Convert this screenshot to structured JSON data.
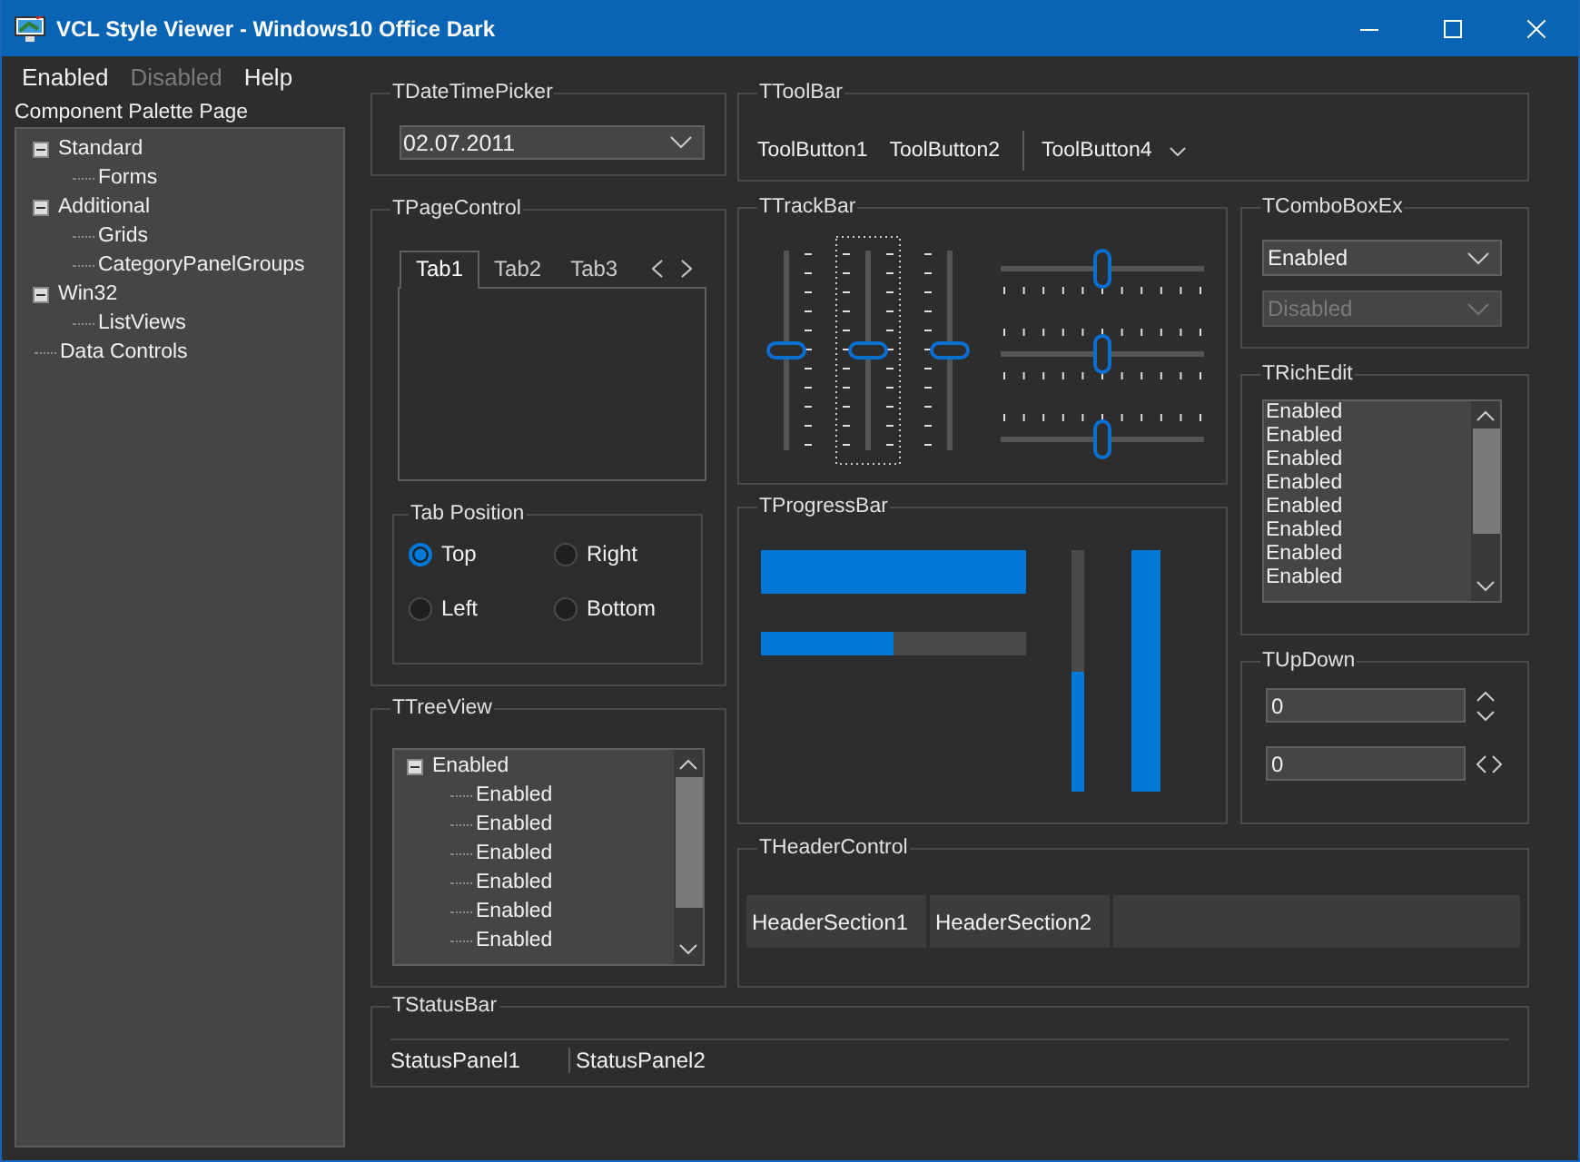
{
  "window": {
    "title": "VCL Style Viewer - Windows10 Office Dark"
  },
  "menu": [
    {
      "label": "Enabled",
      "disabled": false
    },
    {
      "label": "Disabled",
      "disabled": true
    },
    {
      "label": "Help",
      "disabled": false
    }
  ],
  "palette": {
    "title": "Component Palette Page",
    "tree": [
      {
        "label": "Standard",
        "expanded": true,
        "children": [
          {
            "label": "Forms"
          }
        ]
      },
      {
        "label": "Additional",
        "expanded": true,
        "children": [
          {
            "label": "Grids"
          },
          {
            "label": "CategoryPanelGroups"
          }
        ]
      },
      {
        "label": "Win32",
        "expanded": true,
        "children": [
          {
            "label": "ListViews"
          }
        ]
      },
      {
        "label": "Data Controls"
      }
    ]
  },
  "date_time_picker": {
    "title": "TDateTimePicker",
    "value": "02.07.2011"
  },
  "toolbar": {
    "title": "TToolBar",
    "buttons": [
      {
        "kind": "button",
        "label": "ToolButton1"
      },
      {
        "kind": "button",
        "label": "ToolButton2"
      },
      {
        "kind": "separator"
      },
      {
        "kind": "dropdown",
        "label": "ToolButton4"
      }
    ]
  },
  "page_control": {
    "title": "TPageControl",
    "tabs": [
      {
        "label": "Tab1",
        "selected": true
      },
      {
        "label": "Tab2",
        "selected": false
      },
      {
        "label": "Tab3",
        "selected": false
      }
    ],
    "tab_position": {
      "title": "Tab Position",
      "options": [
        {
          "label": "Top",
          "selected": true
        },
        {
          "label": "Right",
          "selected": false
        },
        {
          "label": "Left",
          "selected": false
        },
        {
          "label": "Bottom",
          "selected": false
        }
      ]
    }
  },
  "tree_view": {
    "title": "TTreeView",
    "items": [
      {
        "label": "Enabled",
        "expanded": true,
        "children": [
          {
            "label": "Enabled"
          },
          {
            "label": "Enabled"
          },
          {
            "label": "Enabled"
          },
          {
            "label": "Enabled"
          },
          {
            "label": "Enabled"
          },
          {
            "label": "Enabled"
          }
        ]
      }
    ]
  },
  "track_bar": {
    "title": "TTrackBar",
    "vertical": [
      {
        "level": 0.5,
        "kind": "right",
        "focused": false
      },
      {
        "level": 0.5,
        "kind": "both",
        "focused": true
      },
      {
        "level": 0.5,
        "kind": "left",
        "focused": false
      }
    ],
    "horizontal": [
      {
        "level": 0.5,
        "kind": "below",
        "focused": false
      },
      {
        "level": 0.5,
        "kind": "both",
        "focused": false
      },
      {
        "level": 0.5,
        "kind": "above",
        "focused": false
      }
    ]
  },
  "progress_bar": {
    "title": "TProgressBar",
    "bars": [
      {
        "kind": "horizontal",
        "thick": true,
        "level": 1
      },
      {
        "kind": "horizontal",
        "thick": false,
        "level": 0.5
      },
      {
        "kind": "vertical",
        "thick": false,
        "level": 0.5
      },
      {
        "kind": "vertical",
        "thick": true,
        "level": 1
      }
    ]
  },
  "combo_box_ex": {
    "title": "TComboBoxEx",
    "boxes": [
      {
        "value": "Enabled",
        "disabled": false
      },
      {
        "value": "Disabled",
        "disabled": true
      }
    ]
  },
  "rich_edit": {
    "title": "TRichEdit",
    "lines": [
      "Enabled",
      "Enabled",
      "Enabled",
      "Enabled",
      "Enabled",
      "Enabled",
      "Enabled",
      "Enabled"
    ]
  },
  "up_down": {
    "title": "TUpDown",
    "fields": [
      {
        "value": "0",
        "kind": "vertical"
      },
      {
        "value": "0",
        "kind": "horizontal"
      }
    ]
  },
  "header_control": {
    "title": "THeaderControl",
    "sections": [
      "HeaderSection1",
      "HeaderSection2"
    ]
  },
  "status_bar": {
    "title": "TStatusBar",
    "panels": [
      "StatusPanel1",
      "StatusPanel2"
    ]
  }
}
